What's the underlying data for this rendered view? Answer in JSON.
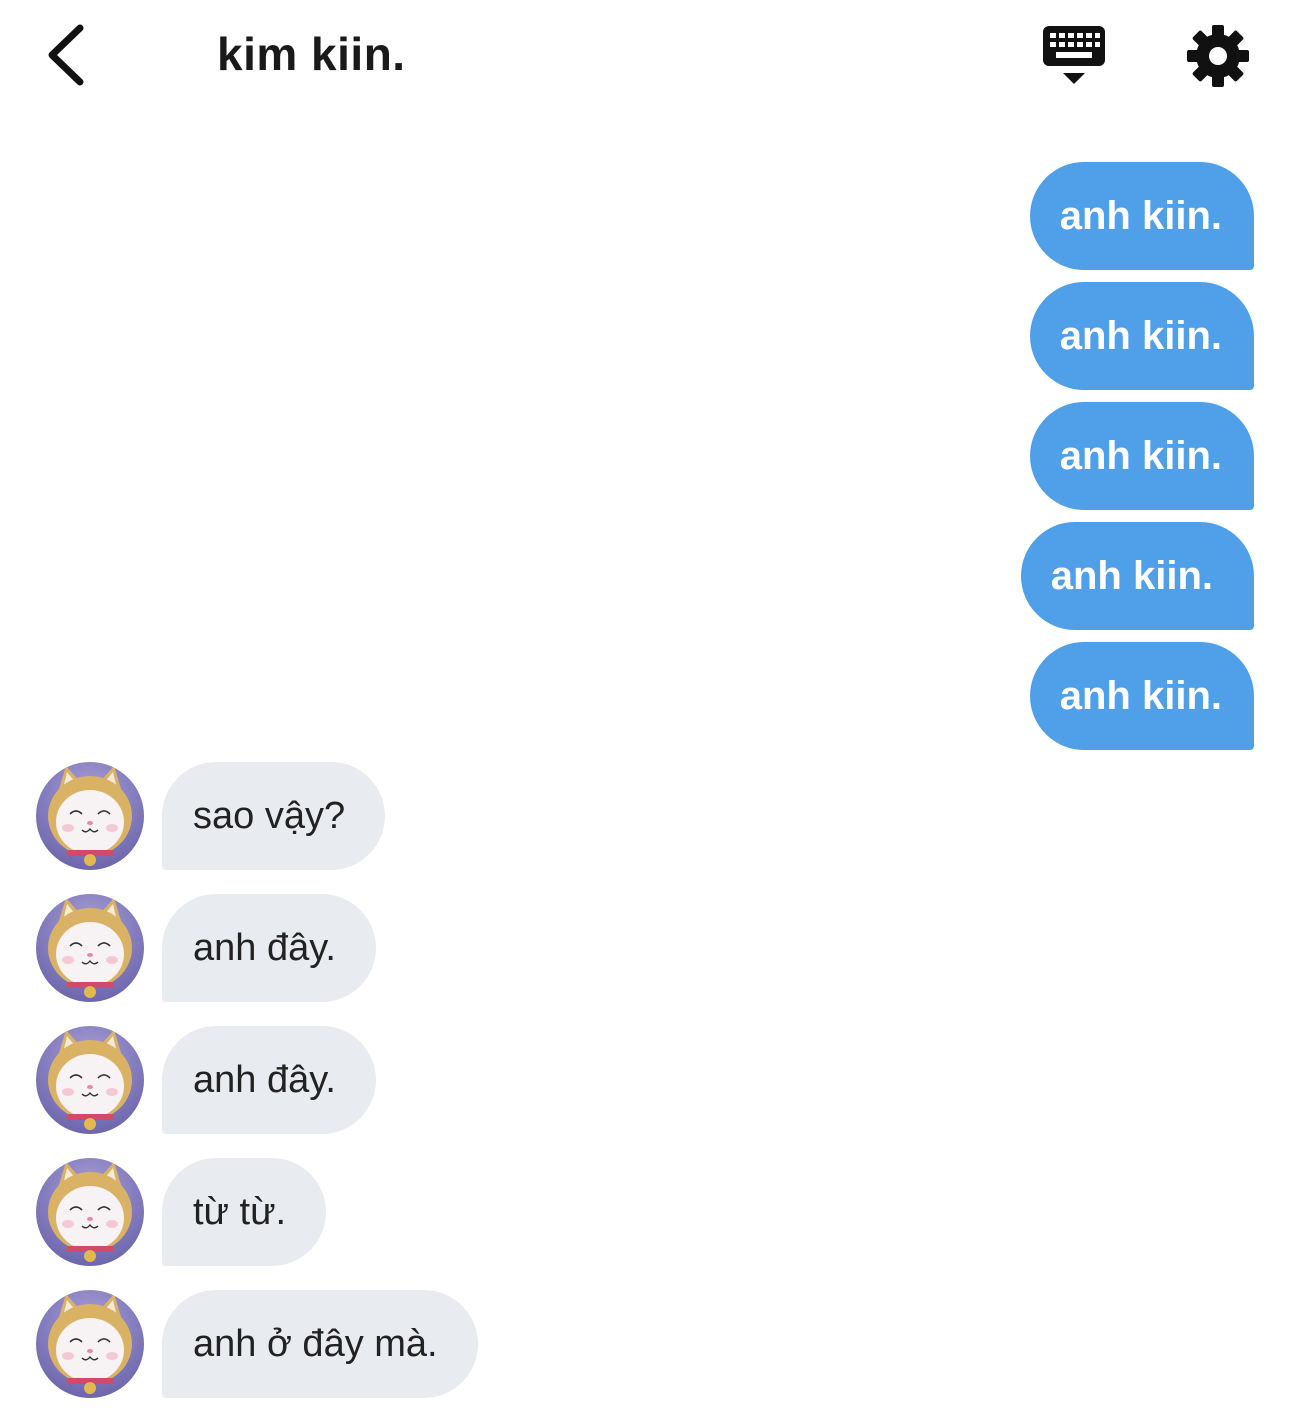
{
  "header": {
    "title": "kim kiin.",
    "back_icon": "chevron-left-icon",
    "keyboard_icon": "keyboard-hide-icon",
    "settings_icon": "gear-icon"
  },
  "messages": {
    "outgoing": [
      {
        "text": "anh kiin."
      },
      {
        "text": "anh kiin."
      },
      {
        "text": "anh kiin."
      },
      {
        "text": "anh kiin."
      },
      {
        "text": "anh kiin."
      }
    ],
    "incoming": [
      {
        "text": "sao vậy?"
      },
      {
        "text": "anh đây."
      },
      {
        "text": "anh đây."
      },
      {
        "text": "từ từ."
      },
      {
        "text": "anh ở đây mà."
      }
    ]
  },
  "colors": {
    "outgoing_bubble": "#4f9fe9",
    "incoming_bubble": "#e8ebef",
    "avatar_bg": "#7d76b8"
  }
}
